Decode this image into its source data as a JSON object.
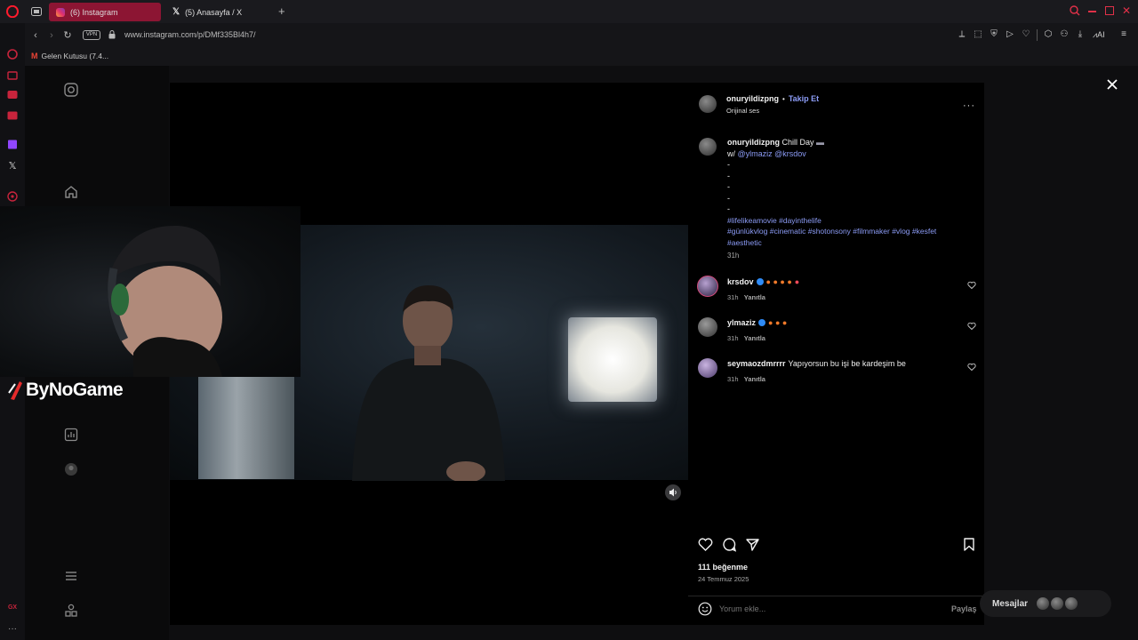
{
  "browser": {
    "tabs": [
      {
        "label": "(6) Instagram"
      },
      {
        "label": "(5) Anasayfa / X"
      }
    ],
    "new_tab": "+",
    "url": "www.instagram.com/p/DMf335Bl4h7/",
    "vpn_label": "VPN",
    "bookmarks": [
      {
        "label": "Gelen Kutusu (7.4..."
      }
    ],
    "toolbar_right_label": "AI"
  },
  "streamer": {
    "brand": "ByNoGame"
  },
  "post": {
    "author": "onuryildizpng",
    "follow_sep": "•",
    "follow_label": "Takip Et",
    "audio": "Orijinal ses",
    "caption": {
      "author": "onuryildizpng",
      "title": "Chill Day",
      "with_prefix": "w/",
      "mentions": "@ylmaziz @krsdov",
      "dashes": [
        "-",
        "-",
        "-",
        "-",
        "-"
      ],
      "hashtags_line1": "#lifelikeamovie #dayinthelife",
      "hashtags_line2": "#günlükvlog #cinematic #shotonsony #filmmaker #vlog #kesfet",
      "hashtags_line3": "#aesthetic",
      "time": "31h"
    },
    "comments": [
      {
        "user": "krsdov",
        "text": "",
        "time": "31h",
        "reply": "Yanıtla",
        "verified": true
      },
      {
        "user": "ylmaziz",
        "text": "",
        "time": "31h",
        "reply": "Yanıtla",
        "verified": true
      },
      {
        "user": "seymaozdmrrrr",
        "text": "Yapıyorsun bu işi be kardeşim be",
        "time": "31h",
        "reply": "Yanıtla",
        "verified": false
      }
    ],
    "likes": "111 beğenme",
    "date": "24 Temmuz 2025",
    "comment_placeholder": "Yorum ekle...",
    "post_button": "Paylaş",
    "messages_label": "Mesajlar"
  }
}
